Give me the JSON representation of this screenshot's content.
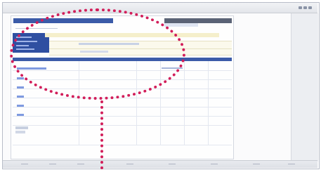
{
  "window": {
    "title": "",
    "controls": [
      "minimize",
      "maximize",
      "close"
    ]
  },
  "highlight": {
    "color": "#d21e5a",
    "shape": "dotted-ellipse-callout"
  },
  "colors": {
    "header_blue": "#3b5ba8",
    "panel_blue": "#2f4fa1",
    "highlight_yellow": "#f5efcb",
    "dark_bar": "#5b6376"
  }
}
